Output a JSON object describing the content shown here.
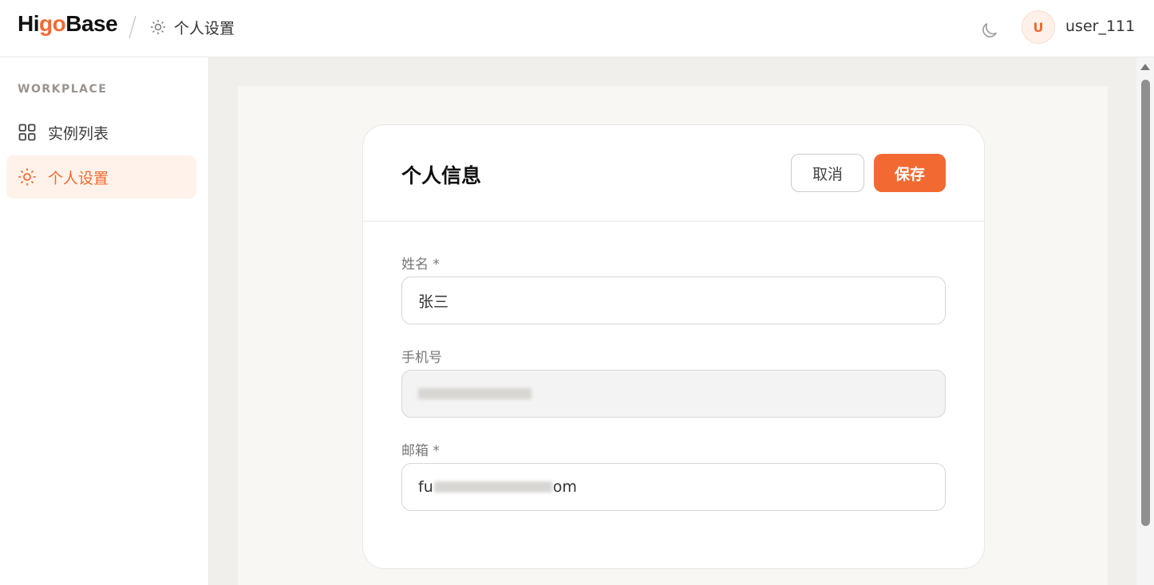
{
  "header": {
    "logo_prefix": "Hi",
    "logo_accent": "go",
    "logo_suffix": "Base",
    "breadcrumb": "个人设置",
    "avatar_letter": "U",
    "username": "user_111"
  },
  "sidebar": {
    "section_label": "WORKPLACE",
    "items": [
      {
        "label": "实例列表",
        "icon": "grid-icon",
        "active": false
      },
      {
        "label": "个人设置",
        "icon": "sun-icon",
        "active": true
      }
    ]
  },
  "card": {
    "title": "个人信息",
    "cancel_label": "取消",
    "save_label": "保存",
    "fields": {
      "name": {
        "label": "姓名 *",
        "value": "张三"
      },
      "phone": {
        "label": "手机号",
        "value": ""
      },
      "email": {
        "label": "邮箱 *",
        "value_start": "fu",
        "value_end": "om"
      }
    }
  },
  "colors": {
    "accent": "#f26a32",
    "active_bg": "#fff2ea"
  }
}
